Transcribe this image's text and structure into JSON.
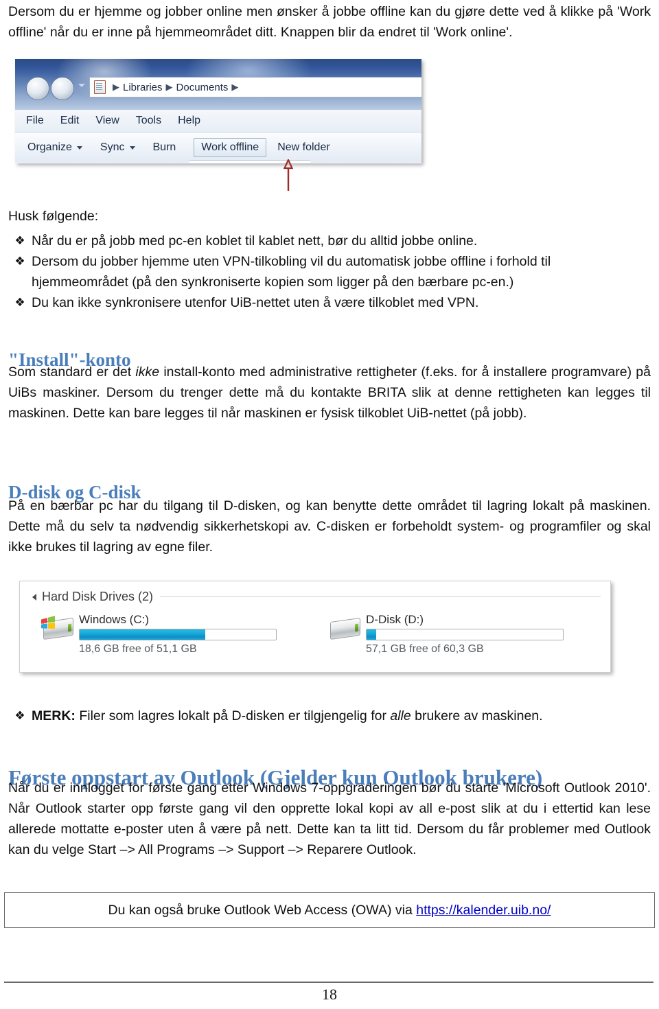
{
  "document": {
    "page_number": "18"
  },
  "intro": {
    "text": "Dersom du er hjemme og jobber online men ønsker å jobbe offline kan du gjøre dette ved å klikke på 'Work offline' når du er inne på hjemmeområdet ditt. Knappen blir da endret til 'Work online'."
  },
  "explorer_screenshot": {
    "name": "windows-explorer-toolbar",
    "back_button": "back-arrow",
    "forward_button": "forward-arrow",
    "history_chevron": "chevron-down-icon",
    "address_icon": "document-icon",
    "breadcrumb": [
      "Libraries",
      "Documents"
    ],
    "breadcrumb_separator": "▶",
    "menu_items": [
      "File",
      "Edit",
      "View",
      "Tools",
      "Help"
    ],
    "toolbar_items": [
      {
        "label": "Organize",
        "has_caret": true,
        "pressed": false
      },
      {
        "label": "Sync",
        "has_caret": true,
        "pressed": false
      },
      {
        "label": "Burn",
        "has_caret": false,
        "pressed": false
      },
      {
        "label": "Work offline",
        "has_caret": false,
        "pressed": true
      },
      {
        "label": "New folder",
        "has_caret": false,
        "pressed": false
      }
    ],
    "annotation_arrow": {
      "name": "red-up-arrow",
      "color": "#9e2b2b",
      "points_to": "Work offline"
    }
  },
  "remember": {
    "heading": "Husk følgende:",
    "bullet_glyph": "❖",
    "items": [
      "Når du er på jobb med pc-en koblet til kablet nett, bør du alltid jobbe online.",
      "Dersom du jobber hjemme uten VPN-tilkobling vil du automatisk jobbe offline i forhold til hjemmeområdet (på den synkroniserte kopien som ligger på den bærbare pc-en.)",
      "Du kan ikke synkronisere utenfor UiB-nettet uten å være tilkoblet med VPN."
    ]
  },
  "install_section": {
    "heading": "\"Install\"-konto",
    "paragraph_part1": "Som standard er det ",
    "paragraph_italic": "ikke",
    "paragraph_part2": " install-konto med administrative rettigheter (f.eks. for å installere programvare) på UiBs maskiner. Dersom du trenger dette må du kontakte BRITA slik at denne rettigheten kan legges til maskinen. Dette kan bare legges til når maskinen er fysisk tilkoblet UiB-nettet (på jobb)."
  },
  "ddisk_section": {
    "heading": "D-disk og C-disk",
    "paragraph": "På en bærbar pc har du tilgang til D-disken, og kan benytte dette området til lagring lokalt på maskinen. Dette må du selv ta nødvendig sikkerhetskopi av. C-disken er forbeholdt system- og programfiler og skal ikke brukes til lagring av egne filer."
  },
  "drives_screenshot": {
    "group_label": "Hard Disk Drives (2)",
    "collapse_icon": "triangle-collapse-icon",
    "accent_color": "#16a9dc",
    "drives": [
      {
        "name": "Windows (C:)",
        "free_text": "18,6 GB free of 51,1 GB",
        "used_percent": 64,
        "icon": "hard-drive-windows-icon"
      },
      {
        "name": "D-Disk (D:)",
        "free_text": "57,1 GB free of 60,3 GB",
        "used_percent": 5,
        "icon": "hard-drive-icon"
      }
    ]
  },
  "merk_note": {
    "glyph": "❖",
    "label": "MERK:",
    "text_part1": " Filer som lagres lokalt på D-disken er tilgjengelig for ",
    "italic": "alle",
    "text_part2": " brukere av maskinen."
  },
  "outlook_section": {
    "heading": "Første oppstart av Outlook (Gjelder kun Outlook brukere)",
    "paragraph": "Når du er innlogget for første gang etter Windows 7-oppgraderingen bør du starte 'Microsoft Outlook 2010'. Når Outlook starter opp første gang vil den opprette lokal kopi av all e-post slik at du i ettertid kan lese allerede mottatte e-poster uten å være på nett. Dette kan ta litt tid. Dersom du får problemer med Outlook kan du velge Start –> All Programs –> Support –> Reparere Outlook."
  },
  "owa_box": {
    "text_before": "Du kan også bruke Outlook Web Access (OWA) via ",
    "link_text": "https://kalender.uib.no/"
  }
}
